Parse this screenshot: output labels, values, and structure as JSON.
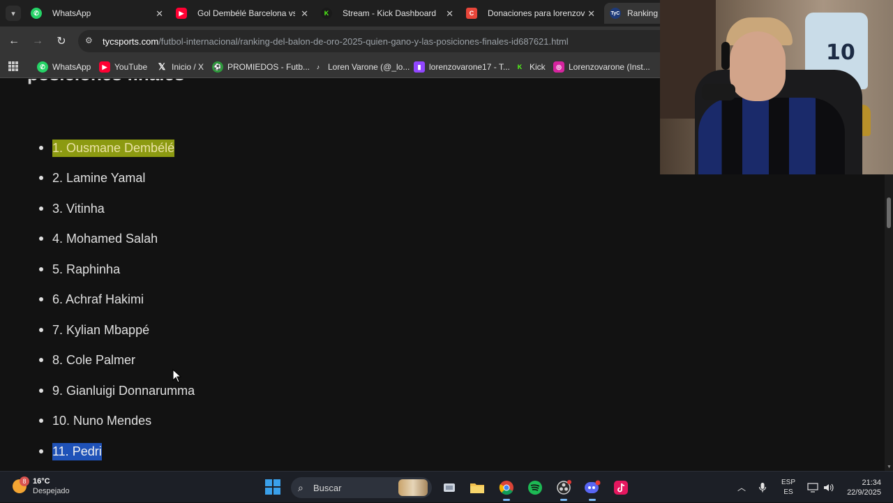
{
  "tabs": [
    {
      "title": "WhatsApp",
      "icon": "whatsapp-icon",
      "color": "#25d366",
      "active": false
    },
    {
      "title": "Gol Dembélé Barcelona vs S",
      "icon": "youtube-icon",
      "color": "#ff0033",
      "active": false
    },
    {
      "title": "Stream - Kick Dashboard",
      "icon": "kick-icon",
      "color": "#53fc18",
      "active": false
    },
    {
      "title": "Donaciones para lorenzovar",
      "icon": "cafecito-icon",
      "color": "#e8463a",
      "active": false
    },
    {
      "title": "Ranking d",
      "icon": "tyc-icon",
      "color": "#1e3a78",
      "active": true
    }
  ],
  "address": {
    "host": "tycsports.com",
    "path": "/futbol-internacional/ranking-del-balon-de-oro-2025-quien-gano-y-las-posiciones-finales-id687621.html"
  },
  "bookmarks": [
    {
      "label": "WhatsApp",
      "icon": "whatsapp-icon",
      "color": "#25d366"
    },
    {
      "label": "YouTube",
      "icon": "youtube-icon",
      "color": "#ff0033"
    },
    {
      "label": "Inicio / X",
      "icon": "x-icon",
      "color": "#000000"
    },
    {
      "label": "PROMIEDOS - Futb...",
      "icon": "promiedos-icon",
      "color": "#2e9a3c"
    },
    {
      "label": "Loren Varone (@_lo...",
      "icon": "tiktok-icon",
      "color": "#111111"
    },
    {
      "label": "lorenzovarone17 - T...",
      "icon": "twitch-icon",
      "color": "#9146ff"
    },
    {
      "label": "Kick",
      "icon": "kick-icon",
      "color": "#53fc18"
    },
    {
      "label": "Lorenzovarone (Inst...",
      "icon": "instagram-icon",
      "color": "#d6249f"
    }
  ],
  "page": {
    "heading": "posiciones finales",
    "ranking": [
      {
        "text": "1. Ousmane Dembélé",
        "highlight": "yellow"
      },
      {
        "text": "2. Lamine Yamal",
        "highlight": ""
      },
      {
        "text": "3. Vitinha",
        "highlight": ""
      },
      {
        "text": "4. Mohamed Salah",
        "highlight": ""
      },
      {
        "text": "5. Raphinha",
        "highlight": ""
      },
      {
        "text": "6. Achraf Hakimi",
        "highlight": ""
      },
      {
        "text": "7. Kylian Mbappé",
        "highlight": ""
      },
      {
        "text": "8. Cole Palmer",
        "highlight": ""
      },
      {
        "text": "9. Gianluigi Donnarumma",
        "highlight": ""
      },
      {
        "text": "10. Nuno Mendes",
        "highlight": ""
      },
      {
        "text": "11. Pedri",
        "highlight": "blue"
      }
    ]
  },
  "webcam": {
    "jersey_number": "10"
  },
  "taskbar": {
    "weather": {
      "badge": "8",
      "temp": "16°C",
      "condition": "Despejado"
    },
    "search_label": "Buscar",
    "apps": [
      "start-icon",
      "task-view-icon",
      "file-explorer-icon",
      "chrome-icon",
      "spotify-icon",
      "obs-icon",
      "discord-icon",
      "tiktok-live-icon"
    ],
    "lang_top": "ESP",
    "lang_bottom": "ES",
    "time": "21:34",
    "date": "22/9/2025"
  }
}
